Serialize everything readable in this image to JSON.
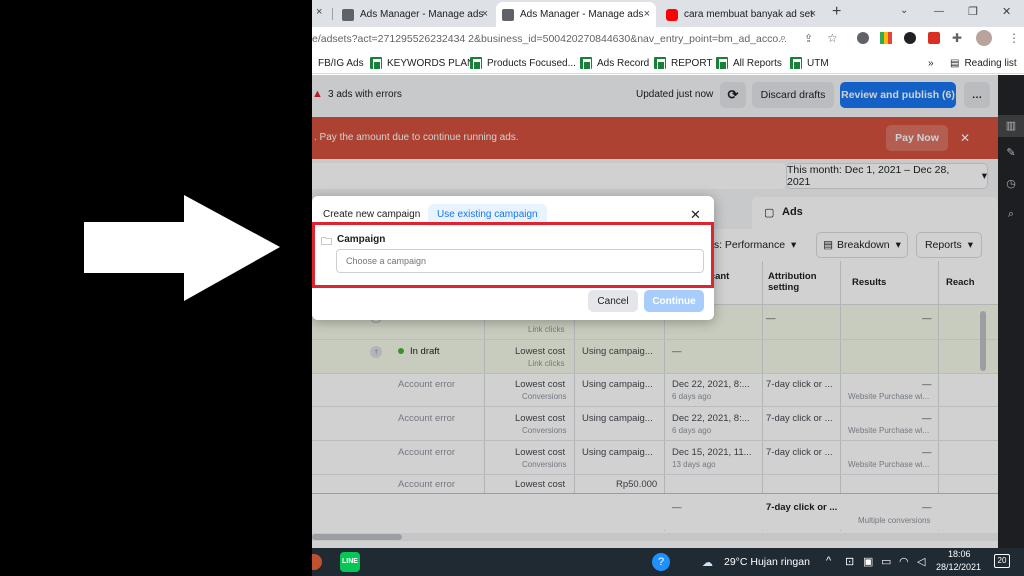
{
  "browser": {
    "tabs": [
      {
        "title": "Ads Manager - Manage ads",
        "close": "×"
      },
      {
        "title": "Ads Manager - Manage ads",
        "close": "×"
      },
      {
        "title": "cara membuat banyak ad set",
        "close": "×"
      }
    ],
    "new_tab": "+",
    "window_controls": {
      "minimize": "—",
      "restore": "❐",
      "close": "✕"
    },
    "url": "e/adsets?act=271295526232434 2&business_id=500420270844630&nav_entry_point=bm_ad_acco...",
    "bookmarks": [
      "FB/IG Ads",
      "KEYWORDS PLAN",
      "Products Focused...",
      "Ads Record",
      "REPORT",
      "All Reports",
      "UTM"
    ],
    "more_bookmarks": "»",
    "reading_list": "Reading list"
  },
  "ads_manager": {
    "errors": "3 ads with errors",
    "updated": "Updated just now",
    "discard": "Discard drafts",
    "publish": "Review and publish (6)",
    "more": "…",
    "banner_text": ". Pay the amount due to continue running ads.",
    "pay_now": "Pay Now",
    "banner_close": "✕",
    "date_range": "This month: Dec 1, 2021 – Dec 28, 2021",
    "ads_tab": "Ads",
    "columns_btn": "ns: Performance",
    "breakdown_btn": "Breakdown",
    "reports_btn": "Reports",
    "headers": [
      "ficant",
      "Attribution setting",
      "Results",
      "Reach"
    ],
    "rows": [
      {
        "status": "",
        "bid": "",
        "bid_sub": "Link clicks",
        "budget": "",
        "date": "",
        "date_sub": "",
        "attr": "—",
        "results": "—",
        "results_sub": ""
      },
      {
        "status": "In draft",
        "bid": "Lowest cost",
        "bid_sub": "Link clicks",
        "budget": "Using campaig...",
        "date": "—",
        "date_sub": "",
        "attr": "—",
        "results": "—",
        "results_sub": ""
      },
      {
        "status": "Account error",
        "bid": "Lowest cost",
        "bid_sub": "Conversions",
        "budget": "Using campaig...",
        "date": "Dec 22, 2021, 8:...",
        "date_sub": "6 days ago",
        "attr": "7-day click or ...",
        "results": "—",
        "results_sub": "Website Purchase wi..."
      },
      {
        "status": "Account error",
        "bid": "Lowest cost",
        "bid_sub": "Conversions",
        "budget": "Using campaig...",
        "date": "Dec 22, 2021, 8:...",
        "date_sub": "6 days ago",
        "attr": "7-day click or ...",
        "results": "—",
        "results_sub": "Website Purchase wi..."
      },
      {
        "status": "Account error",
        "bid": "Lowest cost",
        "bid_sub": "Conversions",
        "budget": "Using campaig...",
        "date": "Dec 15, 2021, 11...",
        "date_sub": "13 days ago",
        "attr": "7-day click or ...",
        "results": "—",
        "results_sub": "Website Purchase wi..."
      },
      {
        "status": "Account error",
        "bid": "Lowest cost",
        "bid_sub": "",
        "budget": "Rp50.000",
        "date": "",
        "date_sub": "",
        "attr": "",
        "results": "",
        "results_sub": ""
      }
    ],
    "totals": {
      "date": "—",
      "attr": "7-day click or ...",
      "results": "—",
      "results_sub": "Multiple conversions"
    }
  },
  "modal": {
    "tab_new": "Create new campaign",
    "tab_existing": "Use existing campaign",
    "close": "✕",
    "section_label": "Campaign",
    "placeholder": "Choose a campaign",
    "cancel": "Cancel",
    "continue": "Continue"
  },
  "taskbar": {
    "weather": "29°C  Hujan ringan",
    "time": "18:06",
    "date": "28/12/2021",
    "notifications": "20"
  },
  "colors": {
    "accent": "#1877f2",
    "banner": "#d4503e",
    "highlight": "#e0242f"
  }
}
